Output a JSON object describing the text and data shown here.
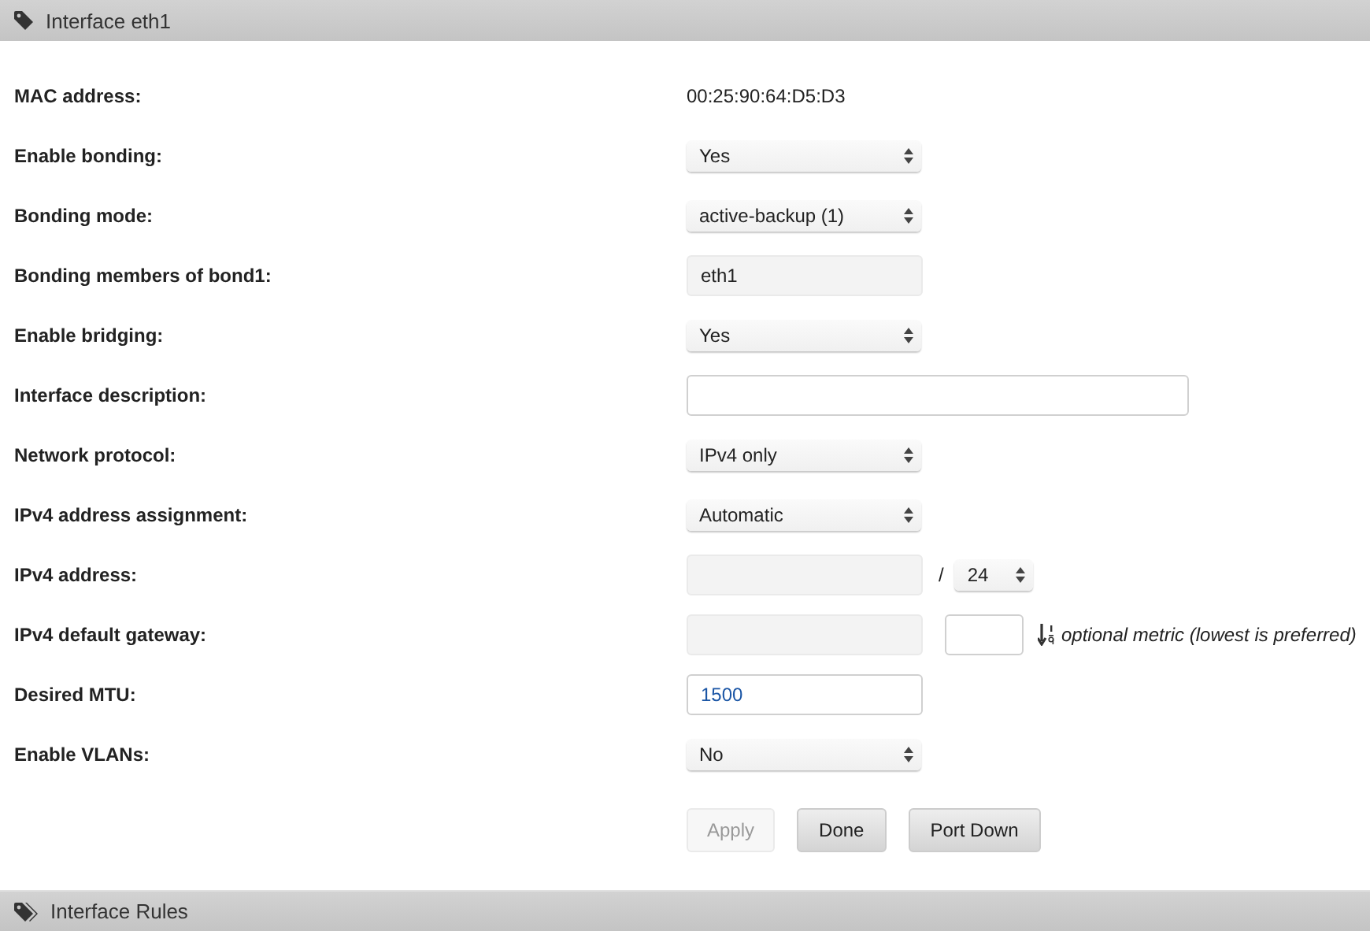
{
  "panel": {
    "title": "Interface eth1"
  },
  "rows": [
    {
      "label": "MAC address:",
      "kind": "text",
      "value": "00:25:90:64:D5:D3"
    },
    {
      "label": "Enable bonding:",
      "kind": "select",
      "value": "Yes"
    },
    {
      "label": "Bonding mode:",
      "kind": "select",
      "value": "active-backup (1)"
    },
    {
      "label": "Bonding members of bond1:",
      "kind": "input",
      "value": "eth1",
      "disabled": true
    },
    {
      "label": "Enable bridging:",
      "kind": "select",
      "value": "Yes"
    },
    {
      "label": "Interface description:",
      "kind": "wide-input",
      "disabled": false
    },
    {
      "label": "Network protocol:",
      "kind": "select",
      "value": "IPv4 only"
    },
    {
      "label": "IPv4 address assignment:",
      "kind": "select",
      "value": "Automatic"
    },
    {
      "label": "IPv4 address:",
      "kind": "address",
      "disabled": true,
      "separator": "/",
      "prefix": "24"
    },
    {
      "label": "IPv4 default gateway:",
      "kind": "gateway",
      "disabled": true,
      "hint": "optional metric (lowest is preferred)"
    },
    {
      "label": "Desired MTU:",
      "kind": "input",
      "value": "1500",
      "disabled": false
    },
    {
      "label": "Enable VLANs:",
      "kind": "select",
      "value": "No"
    }
  ],
  "buttons": [
    {
      "label": "Apply",
      "disabled": true
    },
    {
      "label": "Done",
      "disabled": false
    },
    {
      "label": "Port Down",
      "disabled": false
    }
  ],
  "footer_panel": {
    "title": "Interface Rules"
  }
}
